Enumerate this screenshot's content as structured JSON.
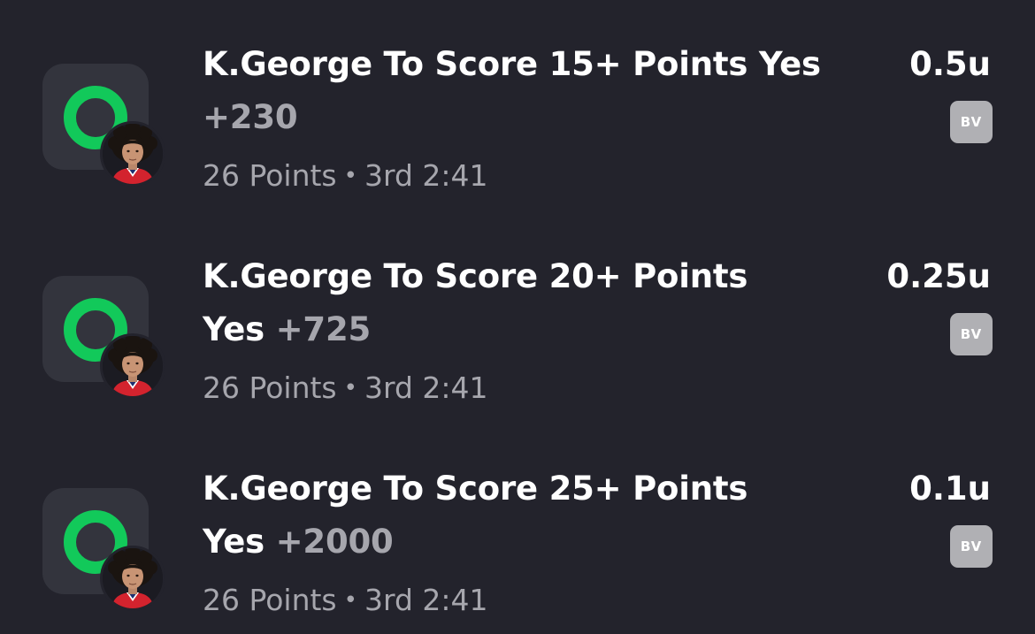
{
  "colors": {
    "background": "#23232c",
    "tile": "#33343d",
    "status_ring": "#12c95a",
    "primary_text": "#ffffff",
    "secondary_text": "#a6a6ad",
    "badge": "#b0b0b4"
  },
  "bets": [
    {
      "icon": "green-ring-status-icon",
      "avatar": "player-avatar",
      "title_line1": "K.George To Score 15+ Points Yes",
      "title_line2_text": "",
      "odds": "+230",
      "result": "26 Points",
      "separator": "•",
      "game_time": "3rd 2:41",
      "units": "0.5u",
      "book": "BV"
    },
    {
      "icon": "green-ring-status-icon",
      "avatar": "player-avatar",
      "title_line1": "K.George To Score 20+ Points",
      "title_line2_text": "Yes",
      "odds": "+725",
      "result": "26 Points",
      "separator": "•",
      "game_time": "3rd 2:41",
      "units": "0.25u",
      "book": "BV"
    },
    {
      "icon": "green-ring-status-icon",
      "avatar": "player-avatar",
      "title_line1": "K.George To Score 25+ Points",
      "title_line2_text": "Yes",
      "odds": "+2000",
      "result": "26 Points",
      "separator": "•",
      "game_time": "3rd 2:41",
      "units": "0.1u",
      "book": "BV"
    }
  ]
}
